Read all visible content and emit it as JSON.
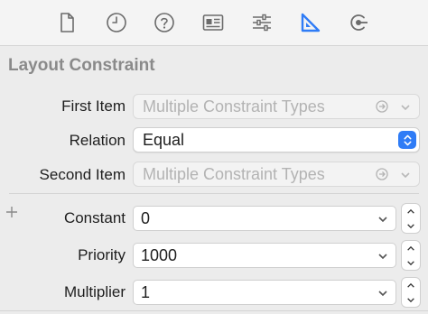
{
  "toolbar": {
    "tabs": [
      {
        "name": "file-inspector",
        "icon": "document-icon"
      },
      {
        "name": "history-inspector",
        "icon": "clock-icon"
      },
      {
        "name": "quick-help-inspector",
        "icon": "question-icon"
      },
      {
        "name": "identity-inspector",
        "icon": "id-card-icon"
      },
      {
        "name": "attributes-inspector",
        "icon": "sliders-icon"
      },
      {
        "name": "size-inspector",
        "icon": "ruler-triangle-icon",
        "selected": true
      },
      {
        "name": "connections-inspector",
        "icon": "connection-arrow-icon"
      }
    ],
    "selected_color": "#2f7cf6"
  },
  "section": {
    "title": "Layout Constraint"
  },
  "first_item": {
    "label": "First Item",
    "value": "Multiple Constraint Types"
  },
  "relation": {
    "label": "Relation",
    "value": "Equal"
  },
  "second_item": {
    "label": "Second Item",
    "value": "Multiple Constraint Types"
  },
  "constant": {
    "label": "Constant",
    "value": "0"
  },
  "priority": {
    "label": "Priority",
    "value": "1000"
  },
  "multiplier": {
    "label": "Multiplier",
    "value": "1"
  },
  "colors": {
    "accent": "#2f7cf6",
    "disabled_text": "#b3b3b3",
    "section_title": "#8a8a8a"
  }
}
